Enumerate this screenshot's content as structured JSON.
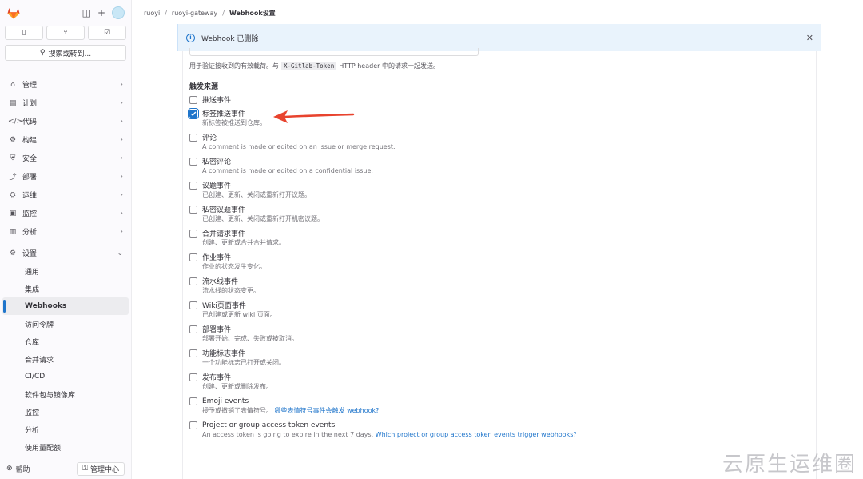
{
  "sidebar": {
    "top_icons": [
      "sidebar-toggle-icon",
      "plus-icon"
    ],
    "quick_buttons": [
      {
        "name": "issues-icon",
        "glyph": "▯"
      },
      {
        "name": "merge-request-icon",
        "glyph": "⑂"
      },
      {
        "name": "todo-icon",
        "glyph": "☑"
      }
    ],
    "search_label": "搜索或转到...",
    "nav": [
      {
        "label": "管理",
        "icon": "⌂"
      },
      {
        "label": "计划",
        "icon": "▤"
      },
      {
        "label": "代码",
        "icon": "</>"
      },
      {
        "label": "构建",
        "icon": "⚙"
      },
      {
        "label": "安全",
        "icon": "⛨"
      },
      {
        "label": "部署",
        "icon": "⤴"
      },
      {
        "label": "运维",
        "icon": "⛭"
      },
      {
        "label": "监控",
        "icon": "▣"
      },
      {
        "label": "分析",
        "icon": "▥"
      }
    ],
    "settings": {
      "label": "设置",
      "icon": "⚙"
    },
    "settings_items": [
      "通用",
      "集成",
      "Webhooks",
      "访问令牌",
      "仓库",
      "合并请求",
      "CI/CD",
      "软件包与镜像库",
      "监控",
      "分析",
      "使用量配额"
    ],
    "active_item": "Webhooks",
    "help_label": "帮助",
    "admin_label": "管理中心"
  },
  "breadcrumb": [
    "ruoyi",
    "ruoyi-gateway",
    "Webhook设置"
  ],
  "alert": {
    "message": "Webhook 已删除"
  },
  "form": {
    "token_help_before": "用于验证接收到的有效载荷。与",
    "token_help_code": "X-Gitlab-Token",
    "token_help_after": "HTTP header 中的请求一起发送。",
    "section_title": "触发来源",
    "triggers": [
      {
        "label": "推送事件",
        "desc": "",
        "checked": false
      },
      {
        "label": "标签推送事件",
        "desc": "新标签被推送到仓库。",
        "checked": true
      },
      {
        "label": "评论",
        "desc": "A comment is made or edited on an issue or merge request.",
        "checked": false
      },
      {
        "label": "私密评论",
        "desc": "A comment is made or edited on a confidential issue.",
        "checked": false
      },
      {
        "label": "议题事件",
        "desc": "已创建、更新、关闭或重新打开议题。",
        "checked": false
      },
      {
        "label": "私密议题事件",
        "desc": "已创建、更新、关闭或重新打开机密议题。",
        "checked": false
      },
      {
        "label": "合并请求事件",
        "desc": "创建、更新或合并合并请求。",
        "checked": false
      },
      {
        "label": "作业事件",
        "desc": "作业的状态发生变化。",
        "checked": false
      },
      {
        "label": "流水线事件",
        "desc": "流水线的状态变更。",
        "checked": false
      },
      {
        "label": "Wiki页面事件",
        "desc": "已创建或更新 wiki 页面。",
        "checked": false
      },
      {
        "label": "部署事件",
        "desc": "部署开始、完成、失败或被取消。",
        "checked": false
      },
      {
        "label": "功能标志事件",
        "desc": "一个功能标志已打开或关闭。",
        "checked": false
      },
      {
        "label": "发布事件",
        "desc": "创建、更新或删除发布。",
        "checked": false
      },
      {
        "label": "Emoji events",
        "desc": "授予或撤销了表情符号。",
        "link": "哪些表情符号事件会触发 webhook?",
        "checked": false
      },
      {
        "label": "Project or group access token events",
        "desc": "An access token is going to expire in the next 7 days.",
        "link": "Which project or group access token events trigger webhooks?",
        "checked": false
      }
    ]
  },
  "watermark": "云原生运维圈",
  "colors": {
    "accent": "#1f75cb",
    "arrow": "#e8432e"
  }
}
